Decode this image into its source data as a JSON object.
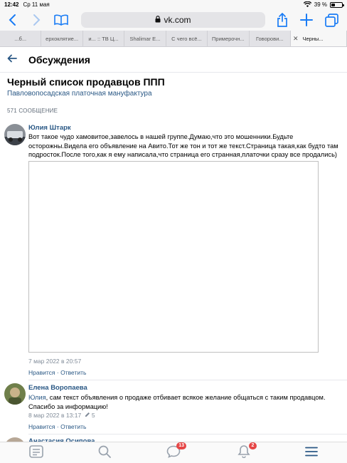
{
  "status_bar": {
    "time": "12:42",
    "date": "Ср 11 мая",
    "battery": "39 %",
    "battery_level": 0.39
  },
  "browser": {
    "url": "vk.com"
  },
  "tabs": [
    {
      "label": "...б..."
    },
    {
      "label": "ерхоклятие..."
    },
    {
      "label": "и... :: ТВ Ц..."
    },
    {
      "label": "Shalimar E..."
    },
    {
      "label": "С чего всё..."
    },
    {
      "label": "Примерочн..."
    },
    {
      "label": "Говорови..."
    },
    {
      "label": "Черны..."
    }
  ],
  "header": {
    "title": "Обсуждения"
  },
  "topic": {
    "title": "Черный список продавцов ППП",
    "group": "Павловопосадская платочная мануфактура",
    "count": "571 СООБЩЕНИЕ"
  },
  "comments": [
    {
      "author": "Юлия Штарк",
      "text_lines": [
        "Вот такое чудо хамовитое,завелось в нашей группе.Думаю,что это мошенники.Будьте",
        "осторожны.Видела его объявление на Авито.Тот же тон и тот же текст.Страница такая,как будто там",
        "подросток.После того,как я ему написала,что страница его странная,платочки сразу все продались)"
      ],
      "date": "7 мар 2022 в 20:57",
      "likes": "Нравится",
      "reply": "Ответить"
    },
    {
      "author": "Елена Воропаева",
      "mention": "Юлия",
      "text_lines": [
        ", сам текст объявления о продаже отбивает всякое желание общаться с таким продавцом.",
        "Спасибо за информацию!"
      ],
      "date": "8 мар 2022 в 13:17",
      "edited": "5",
      "likes": "Нравится",
      "reply": "Ответить"
    },
    {
      "author": "Анастасия Осипова"
    }
  ],
  "bottom_nav": {
    "messages_badge": "13",
    "notifications_badge": "2"
  },
  "icons": {
    "back": "chevron-left-icon",
    "forward": "chevron-right-icon",
    "bookmarks": "book-icon",
    "share": "share-icon",
    "new_tab": "plus-icon",
    "tabs": "tabs-icon"
  },
  "colors": {
    "link": "#2a5885",
    "accent": "#1a7cf5",
    "badge": "#e64646"
  }
}
